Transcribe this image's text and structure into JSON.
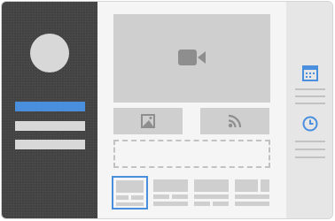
{
  "window": {
    "title": ""
  },
  "sidebar": {
    "avatar_icon": "avatar",
    "items": [
      {
        "name": "nav-item-1",
        "active": true
      },
      {
        "name": "nav-item-2",
        "active": false
      },
      {
        "name": "nav-item-3",
        "active": false
      }
    ]
  },
  "main": {
    "video_icon": "video-camera-icon",
    "tiles": [
      {
        "icon": "image-icon"
      },
      {
        "icon": "rss-feed-icon"
      }
    ],
    "dropzone": {
      "state": "empty"
    },
    "thumbnails": [
      {
        "selected": true
      },
      {
        "selected": false
      },
      {
        "selected": false
      },
      {
        "selected": false
      }
    ]
  },
  "rail": {
    "widgets": [
      {
        "icon": "calendar-icon"
      },
      {
        "icon": "clock-icon"
      }
    ]
  },
  "colors": {
    "sidebar_bg": "#434343",
    "accent": "#4a8fde",
    "placeholder": "#cfcfcf",
    "rail_bg": "#e6e6e6"
  }
}
